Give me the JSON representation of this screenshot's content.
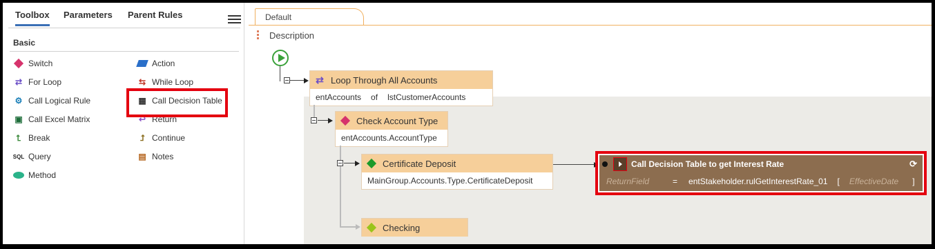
{
  "left_panel": {
    "tabs": [
      "Toolbox",
      "Parameters",
      "Parent Rules"
    ],
    "section": "Basic",
    "tools": [
      {
        "label": "Switch",
        "icon": "pink-diamond-icon"
      },
      {
        "label": "Action",
        "icon": "blue-parallelogram-icon"
      },
      {
        "label": "For Loop",
        "icon": "loop-arrows-icon"
      },
      {
        "label": "While Loop",
        "icon": "while-loop-icon"
      },
      {
        "label": "Call Logical Rule",
        "icon": "logical-rule-icon"
      },
      {
        "label": "Call Decision Table",
        "icon": "decision-table-icon"
      },
      {
        "label": "Call Excel Matrix",
        "icon": "excel-matrix-icon"
      },
      {
        "label": "Return",
        "icon": "return-arrow-icon"
      },
      {
        "label": "Break",
        "icon": "break-icon"
      },
      {
        "label": "Continue",
        "icon": "continue-icon"
      },
      {
        "label": "Query",
        "icon": "sql-query-icon"
      },
      {
        "label": "Notes",
        "icon": "notes-icon"
      },
      {
        "label": "Method",
        "icon": "green-ellipse-icon"
      }
    ]
  },
  "editor": {
    "tab": "Default",
    "description": "Description",
    "nodes": {
      "loop": {
        "title": "Loop Through All Accounts",
        "var": "entAccounts",
        "of": "of",
        "collection": "lstCustomerAccounts"
      },
      "switch": {
        "title": "Check Account Type",
        "expr": "entAccounts.AccountType"
      },
      "case1": {
        "title": "Certificate Deposit",
        "expr": "MainGroup.Accounts.Type.CertificateDeposit"
      },
      "case2": {
        "title": "Checking"
      },
      "action": {
        "title": "Call Decision Table to get Interest Rate",
        "return_field": "ReturnField",
        "equals": "=",
        "target": "entStakeholder.rulGetInterestRate_01",
        "open_bracket": "[",
        "param": "EffectiveDate",
        "close_bracket": "]"
      }
    }
  },
  "colors": {
    "accent": "#3a6fb5",
    "highlight": "#e4000f",
    "node_header": "#f6cf9a",
    "action_bg": "#8c6d4f"
  }
}
